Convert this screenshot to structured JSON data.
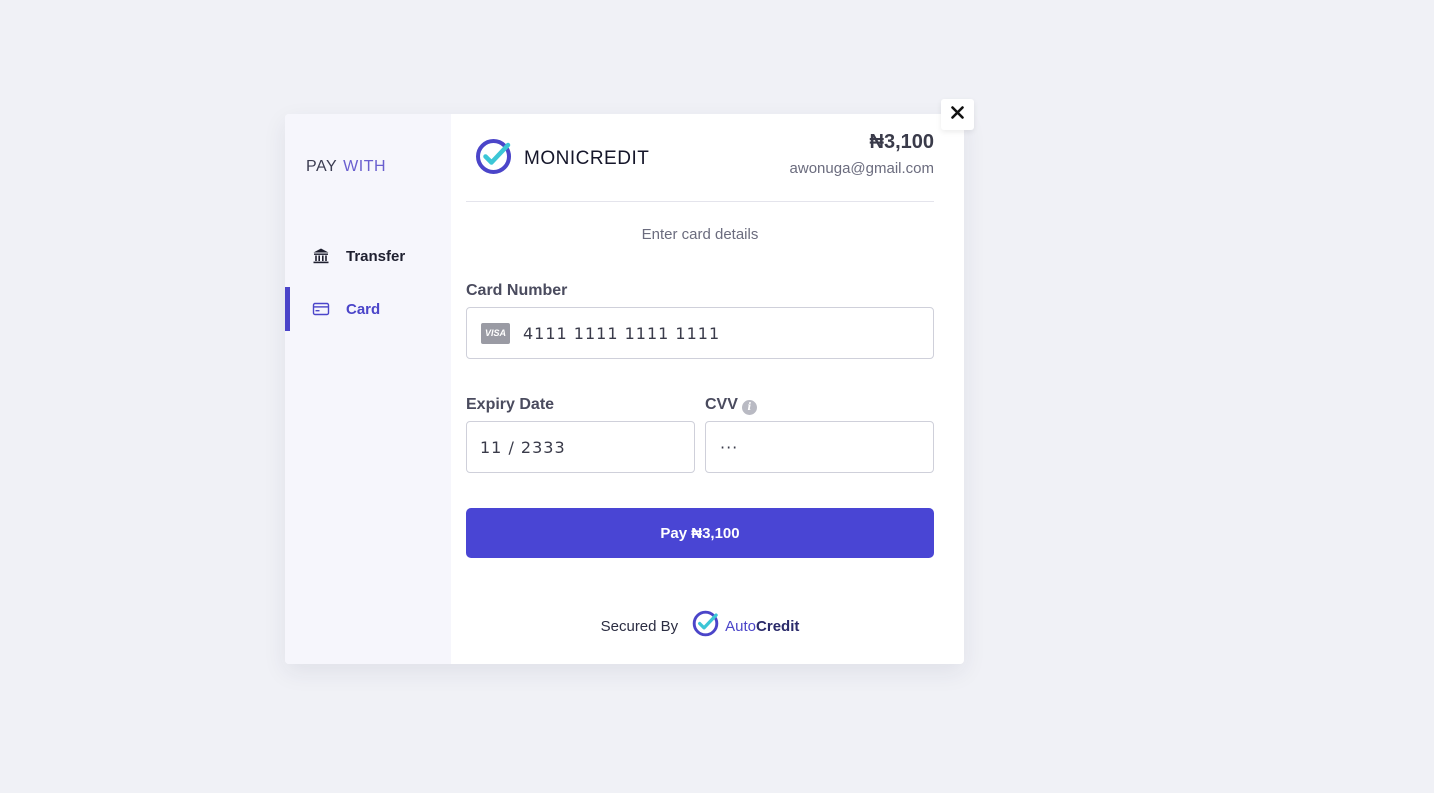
{
  "sidebar": {
    "heading_pay": "PAY",
    "heading_with": "WITH",
    "items": [
      {
        "label": "Transfer",
        "icon": "bank-icon",
        "active": false
      },
      {
        "label": "Card",
        "icon": "credit-card-icon",
        "active": true
      }
    ]
  },
  "header": {
    "brand_name": "MONICREDIT",
    "brand_icon": "check-circle-logo",
    "amount": "₦3,100",
    "email": "awonuga@gmail.com"
  },
  "form": {
    "subtitle": "Enter card details",
    "card_number_label": "Card Number",
    "card_number_value": "4111 1111 1111 1111",
    "card_brand": "VISA",
    "expiry_label": "Expiry Date",
    "expiry_value": "11 / 2333",
    "cvv_label": "CVV",
    "cvv_value": "···",
    "pay_button_label": "Pay ₦3,100"
  },
  "footer": {
    "secured_by": "Secured By",
    "partner_name_light": "Auto",
    "partner_name_bold": "Credit"
  },
  "colors": {
    "accent": "#4945d4",
    "active_nav": "#4b45c9",
    "logo_teal": "#3cc6d6"
  }
}
